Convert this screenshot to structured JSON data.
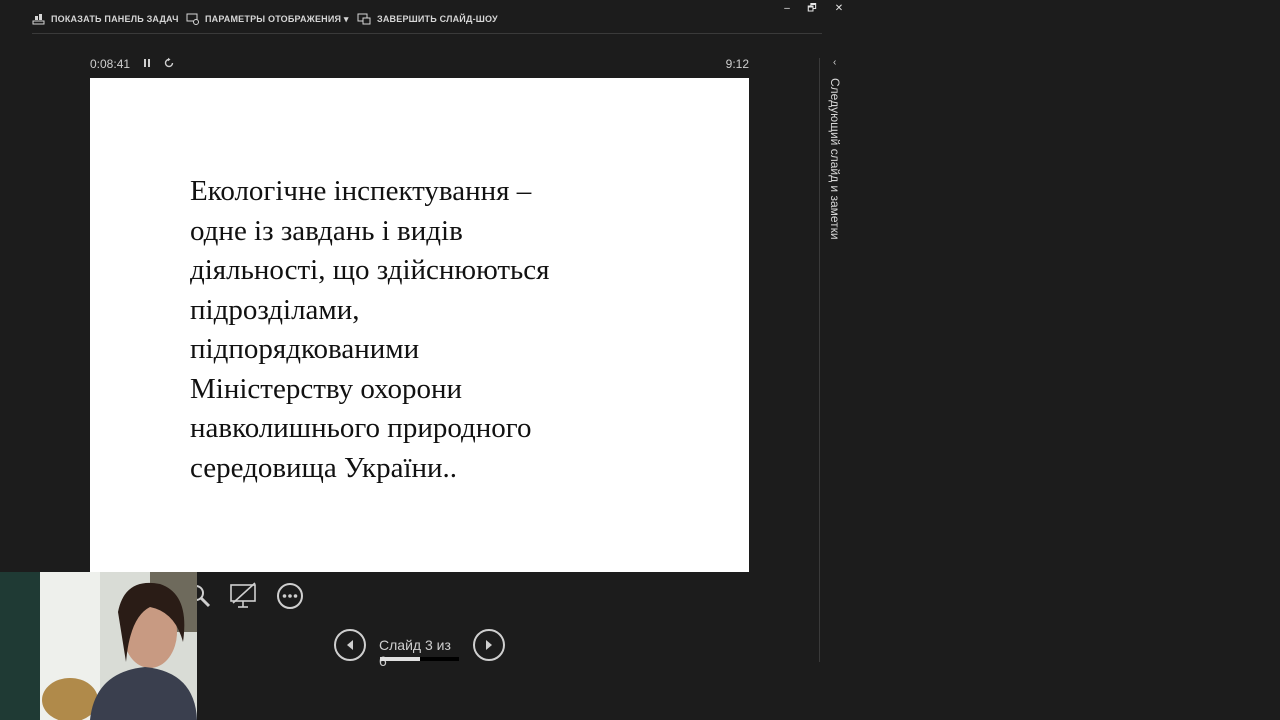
{
  "toolbar": {
    "show_taskbar": "ПОКАЗАТЬ ПАНЕЛЬ ЗАДАЧ",
    "display_settings": "ПАРАМЕТРЫ ОТОБРАЖЕНИЯ ▾",
    "end_show": "ЗАВЕРШИТЬ СЛАЙД-ШОУ"
  },
  "window": {
    "minimize": "–",
    "restore": "🗗",
    "close": "✕"
  },
  "presenter": {
    "elapsed": "0:08:41",
    "clock": "9:12"
  },
  "slide": {
    "lines": [
      "Екологічне інспектування –",
      "одне із завдань і видів",
      "діяльності, що здійснюються",
      "підрозділами,",
      "підпорядкованими",
      "Міністерству охорони",
      "навколишнього природного",
      "середовища України.."
    ]
  },
  "navigation": {
    "counter": "Слайд 3 из 6",
    "progress_fraction": 0.5
  },
  "side_panel": {
    "label": "Следующий слайд и заметки"
  }
}
